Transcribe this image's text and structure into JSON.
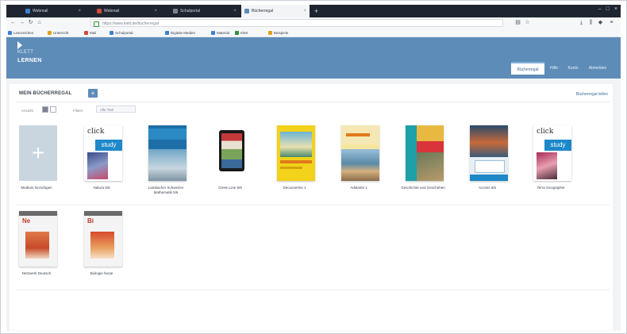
{
  "browser": {
    "tabs": [
      {
        "label": "Webmail",
        "active": false,
        "color": "#3d7fd0"
      },
      {
        "label": "Webmail",
        "active": false,
        "color": "#d04b3d"
      },
      {
        "label": "Schulportal",
        "active": false,
        "color": "#7b8490"
      },
      {
        "label": "Bücherregal",
        "active": true,
        "color": "#5e8cb8"
      }
    ],
    "url": "https://www.klett.de/bücherregal",
    "bookmarks": [
      {
        "label": "Lesezeichen",
        "color": "#3d7fd0"
      },
      {
        "label": "Unterricht",
        "color": "#e0a020"
      },
      {
        "label": "Mail",
        "color": "#d04b3d"
      },
      {
        "label": "Schulportal",
        "color": "#3d7fd0"
      },
      {
        "label": "Digitale Medien",
        "color": "#3d7fd0"
      },
      {
        "label": "Material",
        "color": "#3d7fd0"
      },
      {
        "label": "Klett",
        "color": "#2c8f3a"
      },
      {
        "label": "Beispiele",
        "color": "#e0a020"
      }
    ]
  },
  "header": {
    "brand_line1": "KLETT",
    "brand_line2": "LERNEN",
    "top_right": "",
    "tabs": [
      {
        "label": "Bücherregal",
        "active": true
      },
      {
        "label": "Hilfe",
        "active": false
      },
      {
        "label": "Konto",
        "active": false
      },
      {
        "label": "Abmelden",
        "active": false
      }
    ]
  },
  "main": {
    "title": "MEIN BÜCHERREGAL",
    "add_symbol": "+",
    "right_link": "Bücherregal teilen",
    "view_label": "Ansicht",
    "filter_label": "Filtern",
    "filter_value": "Alle Titel"
  },
  "books": [
    {
      "caption": "Medium hinzufügen",
      "style": "add"
    },
    {
      "caption": "Natura 5/6",
      "style": "clickstudy"
    },
    {
      "caption": "Lambacher Schweizer Mathematik 5/6",
      "style": "bluewater"
    },
    {
      "caption": "Green Line 5/6",
      "style": "tablet"
    },
    {
      "caption": "Découvertes 1",
      "style": "beach"
    },
    {
      "caption": "Adelante 1",
      "style": "ocean"
    },
    {
      "caption": "Geschichte und Geschehen",
      "style": "red"
    },
    {
      "caption": "Access 5/6",
      "style": "surf"
    },
    {
      "caption": "Terra Geographie",
      "style": "clickstudy2"
    },
    {
      "caption": "Netzwerk Deutsch",
      "style": "gray"
    },
    {
      "caption": "Biologie heute",
      "style": "gray2"
    }
  ],
  "brand_color": "#5e8cb8"
}
